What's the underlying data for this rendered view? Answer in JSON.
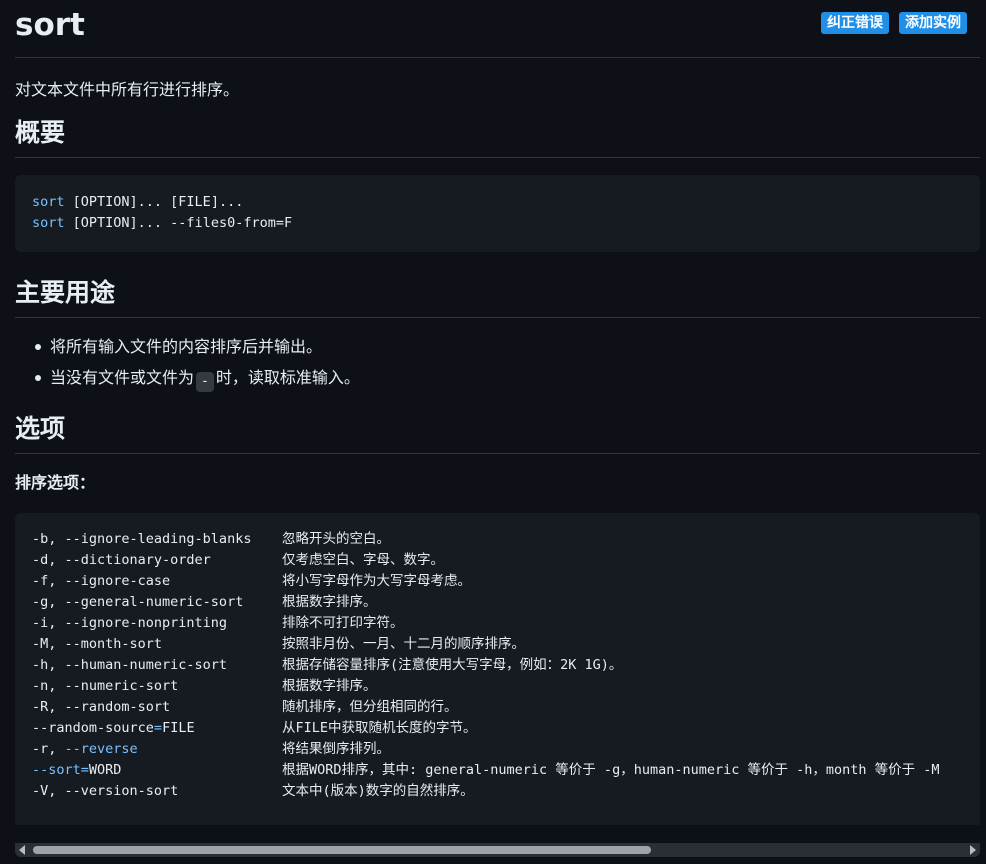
{
  "header": {
    "title": "sort",
    "actions": [
      "纠正错误",
      "添加实例"
    ]
  },
  "description": "对文本文件中所有行进行排序。",
  "synopsis": {
    "heading": "概要",
    "lines": [
      {
        "cmd": "sort",
        "args": " [OPTION]... [FILE]..."
      },
      {
        "cmd": "sort",
        "args": " [OPTION]... --files0-from=F"
      }
    ]
  },
  "usage": {
    "heading": "主要用途",
    "items": [
      {
        "text": "将所有输入文件的内容排序后并输出。"
      },
      {
        "before": "当没有文件或文件为",
        "code": "-",
        "after": "时，读取标准输入。"
      }
    ]
  },
  "options": {
    "heading": "选项",
    "subheading": "排序选项：",
    "rows": [
      {
        "flag": "-b, --ignore-leading-blanks",
        "desc": "忽略开头的空白。"
      },
      {
        "flag": "-d, --dictionary-order",
        "desc": "仅考虑空白、字母、数字。"
      },
      {
        "flag": "-f, --ignore-case",
        "desc": "将小写字母作为大写字母考虑。"
      },
      {
        "flag": "-g, --general-numeric-sort",
        "desc": "根据数字排序。"
      },
      {
        "flag": "-i, --ignore-nonprinting",
        "desc": "排除不可打印字符。"
      },
      {
        "flag": "-M, --month-sort",
        "desc": "按照非月份、一月、十二月的顺序排序。"
      },
      {
        "flag": "-h, --human-numeric-sort",
        "desc": "根据存储容量排序(注意使用大写字母，例如：2K 1G)。"
      },
      {
        "flag": "-n, --numeric-sort",
        "desc": "根据数字排序。"
      },
      {
        "flag": "-R, --random-sort",
        "desc": "随机排序，但分组相同的行。"
      },
      {
        "flag_pre": "--random-source",
        "flag_eq": "=",
        "flag_post": "FILE",
        "desc": "从FILE中获取随机长度的字节。"
      },
      {
        "flag_pre": "-r, ",
        "flag_kw": "--reverse",
        "desc": "将结果倒序排列。"
      },
      {
        "flag_kw": "--sort",
        "flag_eq": "=",
        "flag_post": "WORD",
        "desc": "根据WORD排序，其中: general-numeric 等价于 -g，human-numeric 等价于 -h，month 等价于 -M"
      },
      {
        "flag": "-V, --version-sort",
        "desc": "文本中(版本)数字的自然排序。"
      }
    ]
  },
  "colors": {
    "background": "#0d1117",
    "code_background": "#161b22",
    "accent_button": "#1f8fe8",
    "keyword": "#79c0ff",
    "text": "#e6edf3"
  }
}
